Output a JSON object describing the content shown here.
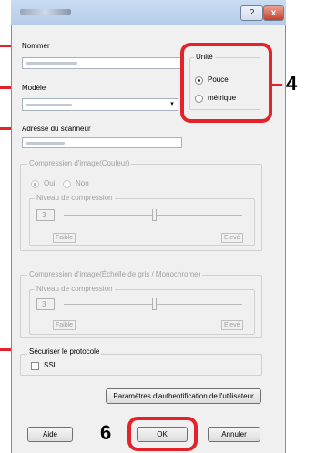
{
  "dialog": {
    "help_label": "?",
    "close_label": "x"
  },
  "fields": {
    "nom_label": "Nommer",
    "modele_label": "Modèle",
    "adresse_label": "Adresse du scanneur"
  },
  "unite": {
    "legend": "Unité",
    "pouce": "Pouce",
    "metrique": "métrique",
    "selected": "Pouce"
  },
  "compression_couleur": {
    "legend": "Compression d'image(Couleur)",
    "oui": "Oui",
    "non": "Non",
    "niveau_legend": "Niveau de compression",
    "value": "3",
    "min_label": "Faible",
    "max_label": "Elevé"
  },
  "compression_gris": {
    "legend": "Compression d'image(Échelle de gris / Monochrome)",
    "niveau_legend": "Niveau de compression",
    "value": "3",
    "min_label": "Faible",
    "max_label": "Elevé"
  },
  "securiser": {
    "legend": "Sécuriser le protocole",
    "ssl_label": "SSL"
  },
  "buttons": {
    "auth": "Paramètres d'authentification de l'utilisateur",
    "aide": "Aide",
    "ok": "OK",
    "annuler": "Annuler"
  },
  "callouts": {
    "unite_number": "4",
    "ok_number": "6"
  },
  "colors": {
    "callout_red": "#e3222a",
    "titlebar": "#c9dcf2",
    "dialog_bg": "#f0f0f0"
  }
}
